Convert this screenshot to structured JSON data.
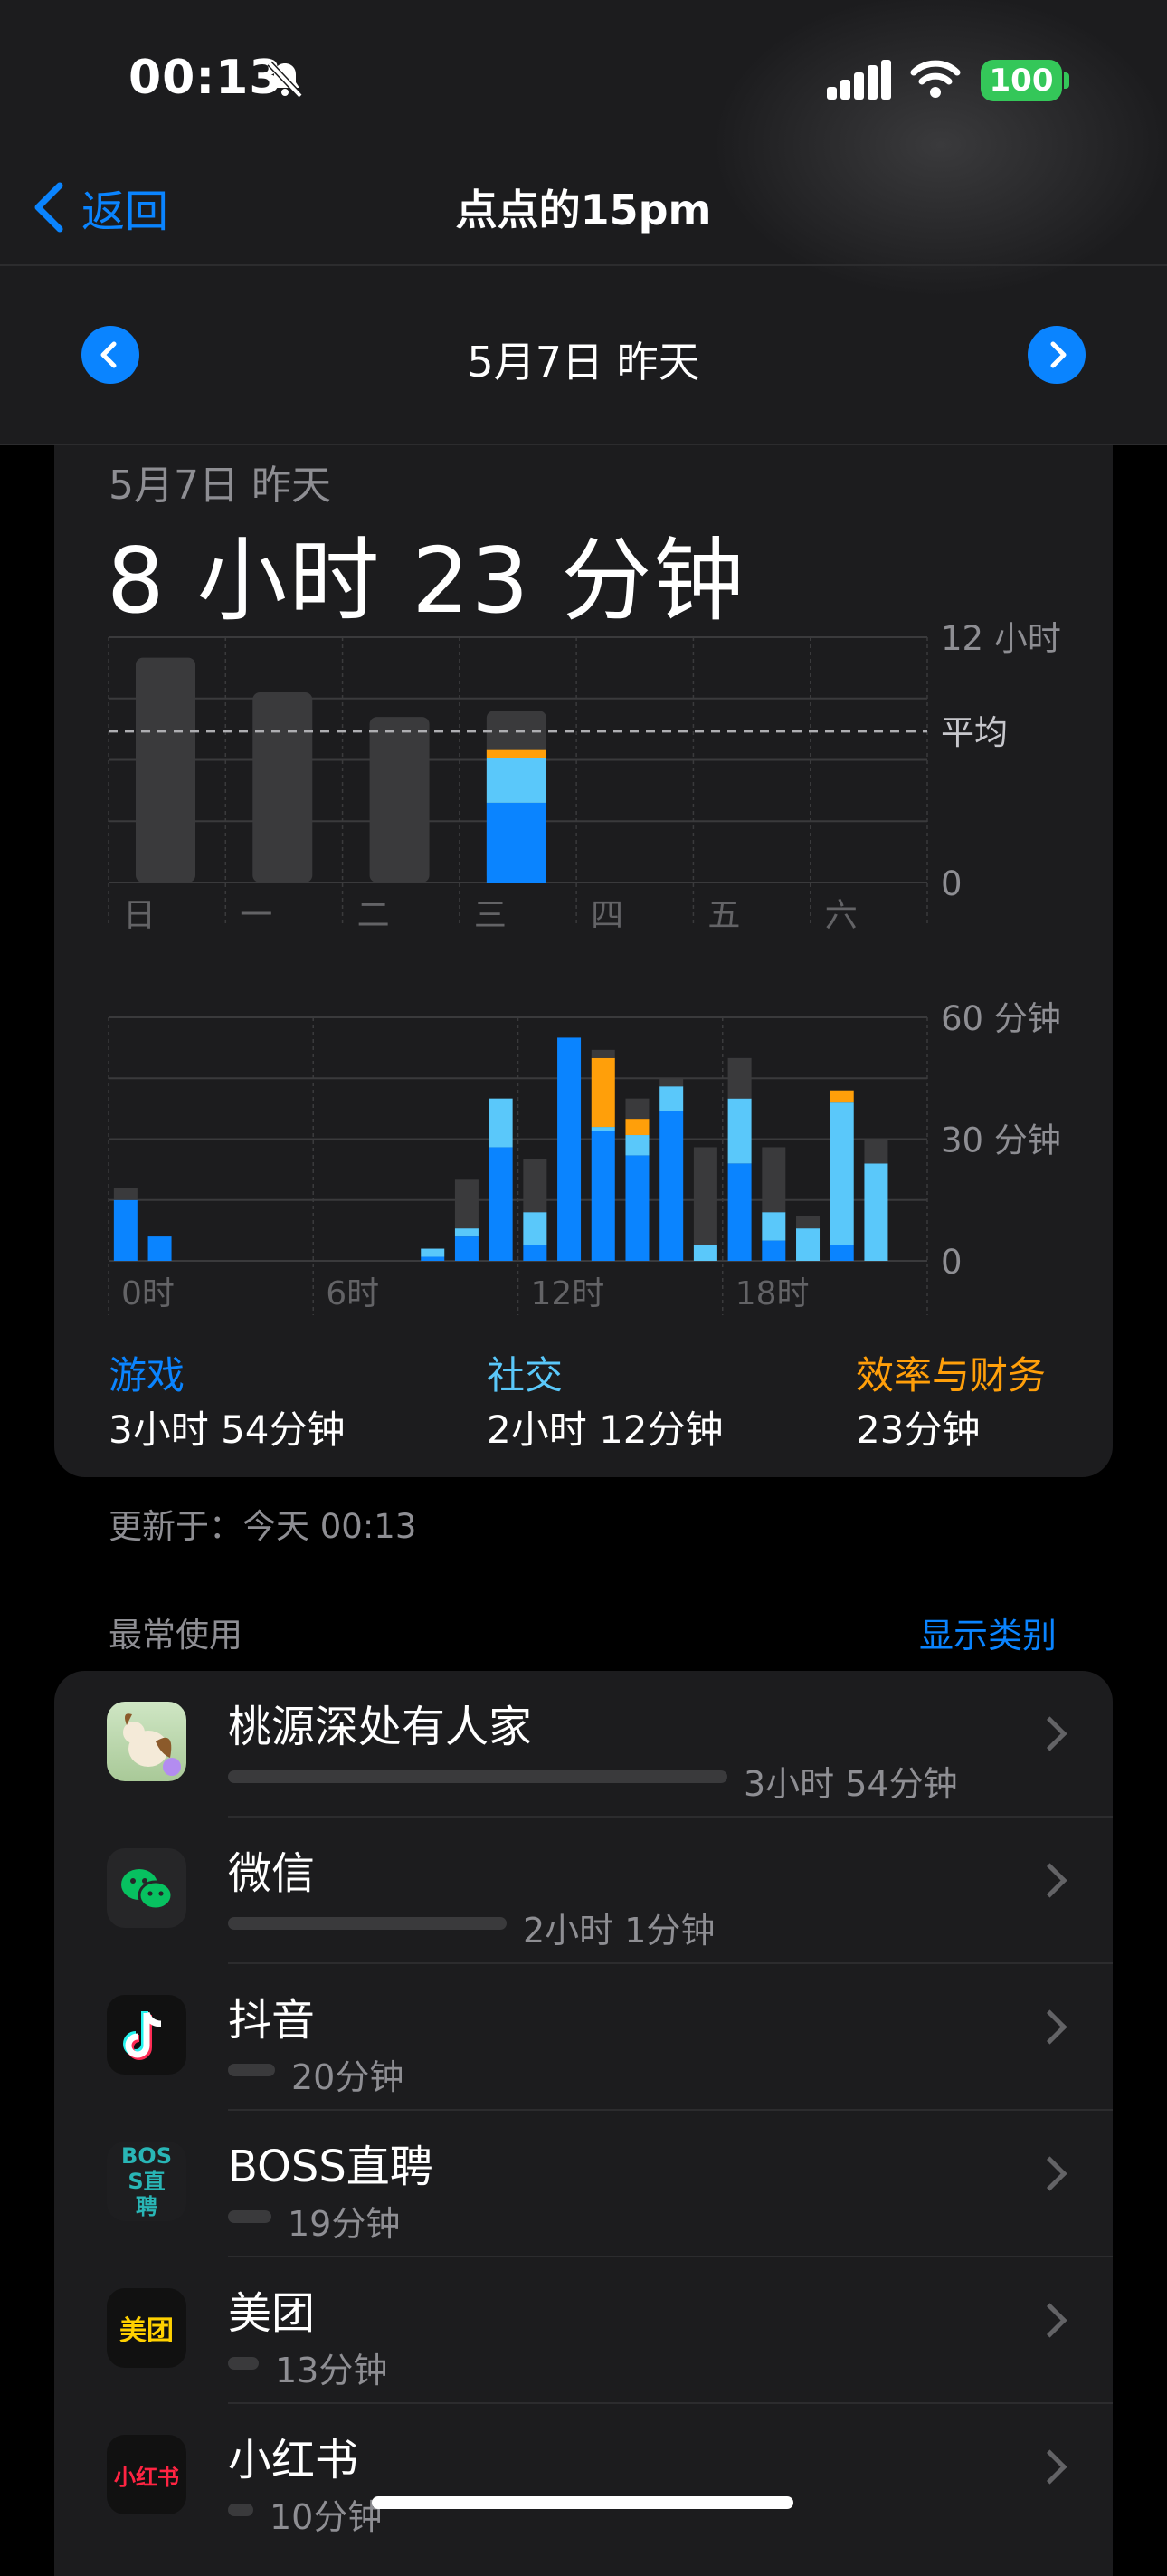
{
  "status_bar": {
    "time": "00:13",
    "battery": "100"
  },
  "nav": {
    "back_label": "返回",
    "title": "点点的15pm"
  },
  "date_bar": {
    "title": "5月7日 昨天"
  },
  "summary": {
    "date": "5月7日 昨天",
    "total": "8 小时 23 分钟"
  },
  "daily_chart_labels": {
    "y_top": "12 小时",
    "avg": "平均",
    "y_zero": "0"
  },
  "hourly_chart_labels": {
    "y_top": "60 分钟",
    "y_mid": "30 分钟",
    "y_zero": "0"
  },
  "chart_data": [
    {
      "type": "bar",
      "categories": [
        "日",
        "一",
        "二",
        "三",
        "四",
        "五",
        "六"
      ],
      "series": [
        {
          "values": [
            11.0,
            9.3,
            8.1,
            8.4,
            null,
            null,
            null
          ]
        }
      ],
      "breakdown_day": "三",
      "breakdown": [
        {
          "name": "游戏",
          "value": 3.9
        },
        {
          "name": "社交",
          "value": 2.2
        },
        {
          "name": "效率与财务",
          "value": 0.38
        }
      ],
      "average": 7.4,
      "ylim": [
        0,
        12
      ],
      "ytick_labels": [
        "12 小时",
        "平均",
        "0"
      ]
    },
    {
      "type": "bar",
      "x_tick_labels": [
        "0时",
        "6时",
        "12时",
        "18时"
      ],
      "x": [
        0,
        1,
        2,
        3,
        4,
        5,
        6,
        7,
        8,
        9,
        10,
        11,
        12,
        13,
        14,
        15,
        16,
        17,
        18,
        19,
        20,
        21,
        22,
        23
      ],
      "series": [
        {
          "name": "游戏",
          "values": [
            15,
            6,
            0,
            0,
            0,
            0,
            0,
            0,
            0,
            1,
            6,
            28,
            4,
            55,
            32,
            26,
            37,
            0,
            24,
            5,
            0,
            4,
            0,
            0
          ]
        },
        {
          "name": "社交",
          "values": [
            0,
            0,
            0,
            0,
            0,
            0,
            0,
            0,
            0,
            2,
            2,
            12,
            8,
            0,
            1,
            5,
            6,
            4,
            16,
            7,
            8,
            35,
            24,
            0
          ]
        },
        {
          "name": "效率与财务",
          "values": [
            0,
            0,
            0,
            0,
            0,
            0,
            0,
            0,
            0,
            0,
            0,
            0,
            0,
            0,
            17,
            4,
            0,
            0,
            0,
            0,
            0,
            3,
            0,
            0
          ]
        },
        {
          "name": "其他",
          "values": [
            3,
            0,
            0,
            0,
            0,
            0,
            0,
            0,
            0,
            0,
            12,
            0,
            13,
            0,
            2,
            5,
            2,
            24,
            10,
            16,
            3,
            0,
            6,
            0
          ]
        }
      ],
      "ylim": [
        0,
        60
      ],
      "ytick_labels": [
        "60 分钟",
        "30 分钟",
        "0"
      ]
    }
  ],
  "categories": [
    {
      "name": "游戏",
      "value": "3小时 54分钟",
      "color": "#0a84ff"
    },
    {
      "name": "社交",
      "value": "2小时 12分钟",
      "color": "#5ac8fa"
    },
    {
      "name": "效率与财务",
      "value": "23分钟",
      "color": "#ff9f0a"
    }
  ],
  "updated": "更新于：今天 00:13",
  "most_used": {
    "title": "最常使用",
    "show_categories": "显示类别"
  },
  "apps": [
    {
      "name": "桃源深处有人家",
      "duration": "3小时 54分钟",
      "usage_fraction": 1.0,
      "icon": "game-app-icon"
    },
    {
      "name": "微信",
      "duration": "2小时 1分钟",
      "usage_fraction": 0.52,
      "icon": "wechat-icon"
    },
    {
      "name": "抖音",
      "duration": "20分钟",
      "usage_fraction": 0.09,
      "icon": "douyin-icon"
    },
    {
      "name": "BOSS直聘",
      "duration": "19分钟",
      "usage_fraction": 0.08,
      "icon": "boss-icon",
      "icon_text": "BOSS直聘"
    },
    {
      "name": "美团",
      "duration": "13分钟",
      "usage_fraction": 0.06,
      "icon": "meituan-icon",
      "icon_text": "美团"
    },
    {
      "name": "小红书",
      "duration": "10分钟",
      "usage_fraction": 0.05,
      "icon": "xiaohongshu-icon",
      "icon_text": "小红书"
    }
  ]
}
